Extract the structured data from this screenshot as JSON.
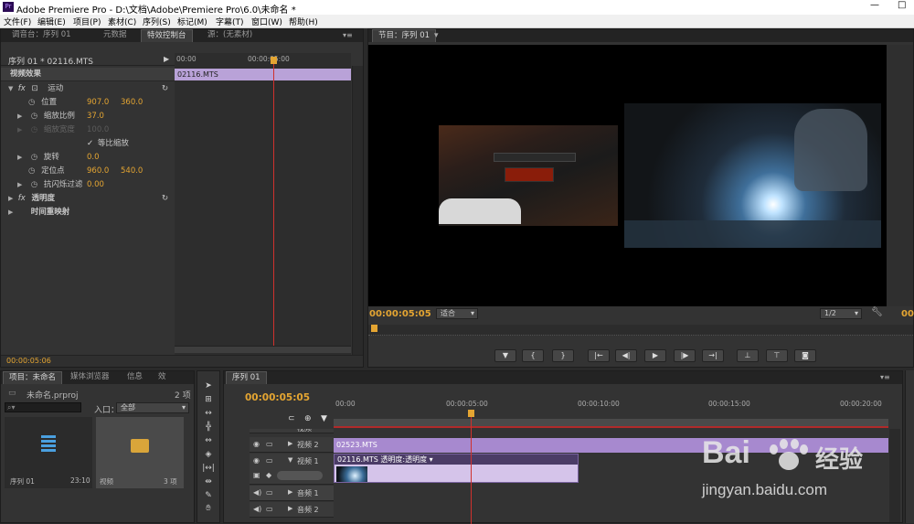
{
  "window": {
    "title": "Adobe Premiere Pro - D:\\文档\\Adobe\\Premiere Pro\\6.0\\未命名 *",
    "controls": {
      "minimize": "—",
      "maximize": "□"
    }
  },
  "menu": [
    "文件(F)",
    "编辑(E)",
    "项目(P)",
    "素材(C)",
    "序列(S)",
    "标记(M)",
    "字幕(T)",
    "窗口(W)",
    "帮助(H)"
  ],
  "effect_panel": {
    "tabs": [
      "调音台：序列 01",
      "元数据",
      "特效控制台",
      "源：(无素材)"
    ],
    "header": "序列 01 * 02116.MTS",
    "ruler_start": "00:00",
    "ruler_mid": "00:00:05:00",
    "clip_name": "02116.MTS",
    "section_title": "视频效果",
    "motion_label": "运动",
    "position_label": "位置",
    "position_x": "907.0",
    "position_y": "360.0",
    "scale_label": "缩放比例",
    "scale_value": "37.0",
    "scale_width_label": "缩放宽度",
    "scale_width_value": "100.0",
    "uniform_label": "等比缩放",
    "rotation_label": "旋转",
    "rotation_value": "0.0",
    "anchor_label": "定位点",
    "anchor_x": "960.0",
    "anchor_y": "540.0",
    "antiflicker_label": "抗闪烁过滤",
    "antiflicker_value": "0.00",
    "opacity_label": "透明度",
    "timeremap_label": "时间重映射",
    "bottom_timecode": "00:00:05:06"
  },
  "program_monitor": {
    "tab": "节目：序列 01",
    "timecode": "00:00:05:05",
    "fit": "适合",
    "quality": "1/2",
    "end_timecode": "00"
  },
  "project_panel": {
    "tabs": [
      "项目：未命名",
      "媒体浏览器",
      "信息",
      "效"
    ],
    "project_file": "未命名.prproj",
    "item_count": "2 项",
    "in_label": "入口：",
    "in_value": "全部",
    "items": [
      {
        "name": "序列 01",
        "meta": "23:10"
      },
      {
        "name": "视频",
        "meta": "3 项"
      }
    ]
  },
  "timeline": {
    "tab": "序列 01",
    "timecode": "00:00:05:05",
    "ruler": [
      "00:00",
      "00:00:05:00",
      "00:00:10:00",
      "00:00:15:00",
      "00:00:20:00"
    ],
    "tracks": [
      {
        "name": "视频 2",
        "clip": "02523.MTS"
      },
      {
        "name": "视频 1",
        "clip": "02116.MTS  透明度:透明度 ▾"
      },
      {
        "name": "音频 1"
      },
      {
        "name": "音频 2"
      }
    ],
    "hidden_track_label": "视频"
  },
  "watermark": {
    "brand": "Bai",
    "brand2": "经验",
    "url": "jingyan.baidu.com"
  }
}
